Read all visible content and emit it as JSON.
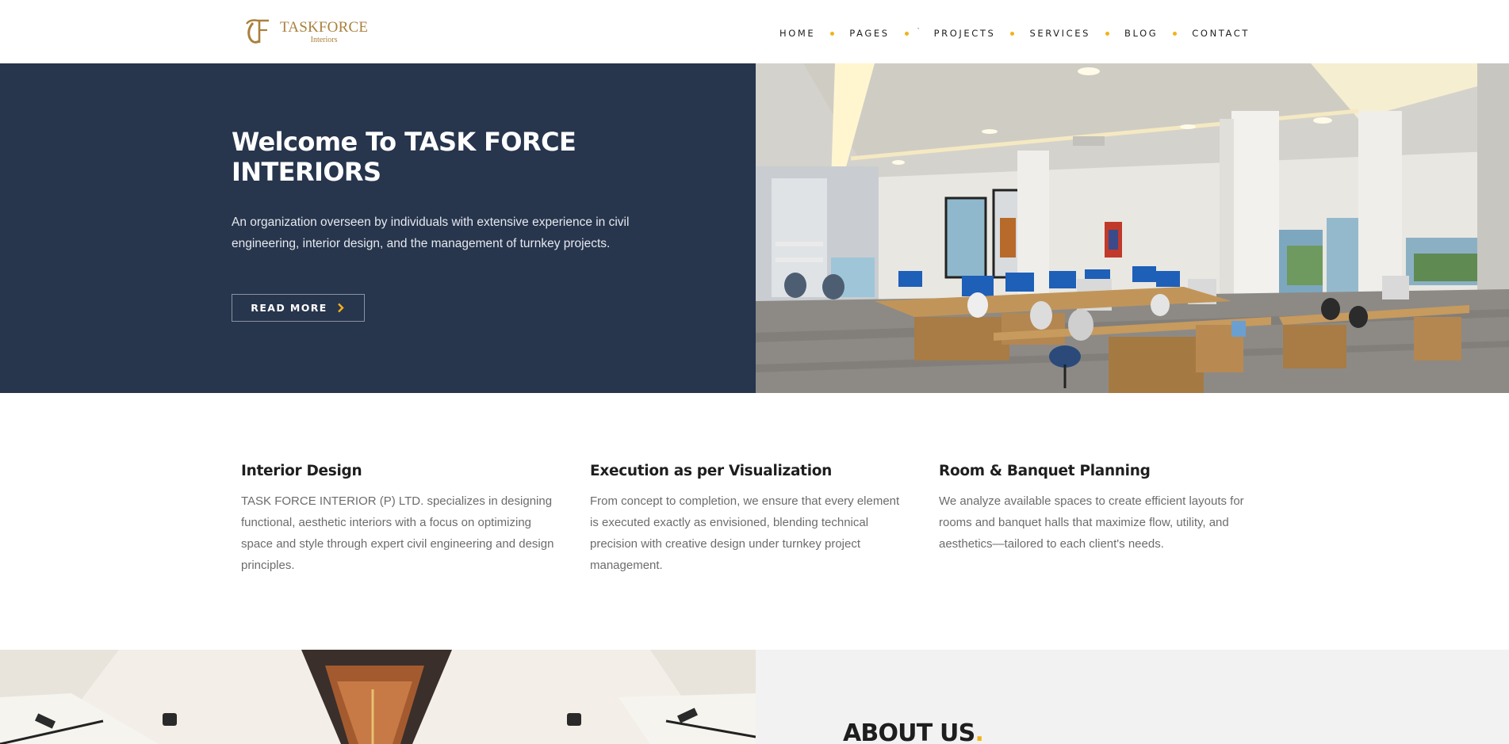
{
  "brand": {
    "name": "TASKFORCE",
    "sub": "Interiors",
    "accent": "#a9803d"
  },
  "nav": {
    "items": [
      "HOME",
      "PAGES",
      "PROJECTS",
      "SERVICES",
      "BLOG",
      "CONTACT"
    ],
    "caret": "ˋ",
    "dot_color": "#f2b21b"
  },
  "hero": {
    "title": "Welcome To TASK FORCE INTERIORS",
    "description": "An organization overseen by individuals with extensive experience in civil engineering, interior design, and the management of turnkey projects.",
    "button_label": "READ MORE",
    "bg_color": "#27354d"
  },
  "services": [
    {
      "title": "Interior Design",
      "text": "TASK FORCE INTERIOR (P) LTD. specializes in designing functional, aesthetic interiors with a focus on optimizing space and style through expert civil engineering and design principles."
    },
    {
      "title": "Execution as per Visualization",
      "text": "From concept to completion, we ensure that every element is executed exactly as envisioned, blending technical precision with creative design under turnkey project management."
    },
    {
      "title": "Room & Banquet Planning",
      "text": "We analyze available spaces to create efficient layouts for rooms and banquet halls that maximize flow, utility, and aesthetics—tailored to each client's needs."
    }
  ],
  "about": {
    "title": "ABOUT US",
    "dot": "."
  }
}
